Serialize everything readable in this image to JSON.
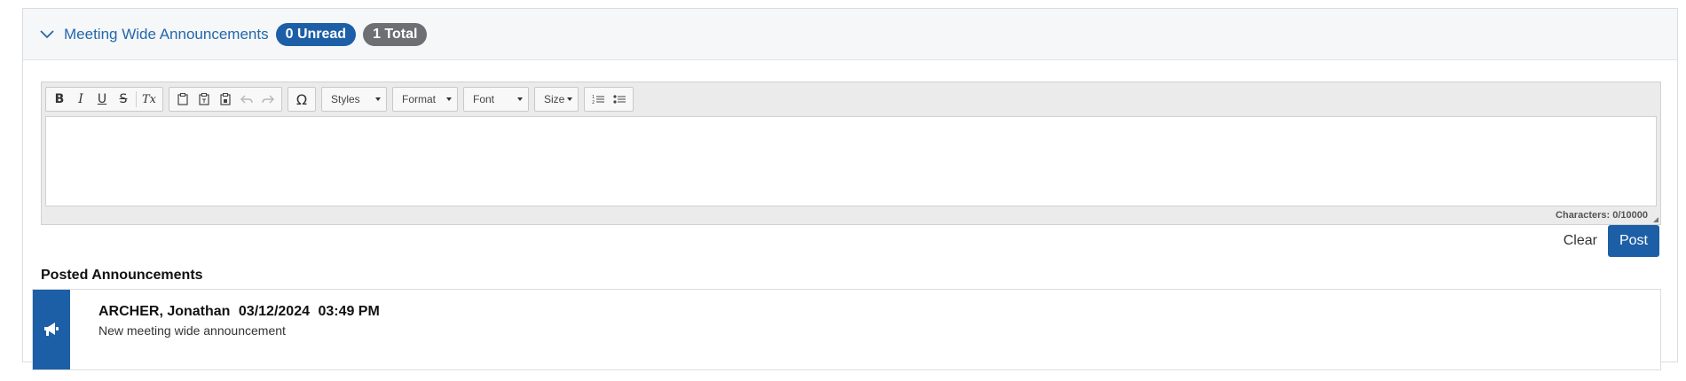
{
  "header": {
    "title": "Meeting Wide Announcements",
    "unread_badge": "0 Unread",
    "total_badge": "1 Total"
  },
  "editor": {
    "toolbar": {
      "bold": "B",
      "italic": "I",
      "underline": "U",
      "strike": "S",
      "remove_format": "Tx",
      "special_char": "Ω",
      "styles_label": "Styles",
      "format_label": "Format",
      "font_label": "Font",
      "size_label": "Size"
    },
    "content": "",
    "char_count": "Characters: 0/10000"
  },
  "actions": {
    "clear_label": "Clear",
    "post_label": "Post"
  },
  "posted": {
    "heading": "Posted Announcements",
    "items": [
      {
        "author": "ARCHER, Jonathan",
        "date": "03/12/2024",
        "time": "03:49 PM",
        "text": "New meeting wide announcement"
      }
    ]
  },
  "colors": {
    "accent": "#1d5fa6",
    "link": "#2468a8",
    "total_badge": "#6c6f73"
  },
  "icons": {
    "collapse": "chevron-down-icon",
    "announcement": "megaphone-icon"
  }
}
